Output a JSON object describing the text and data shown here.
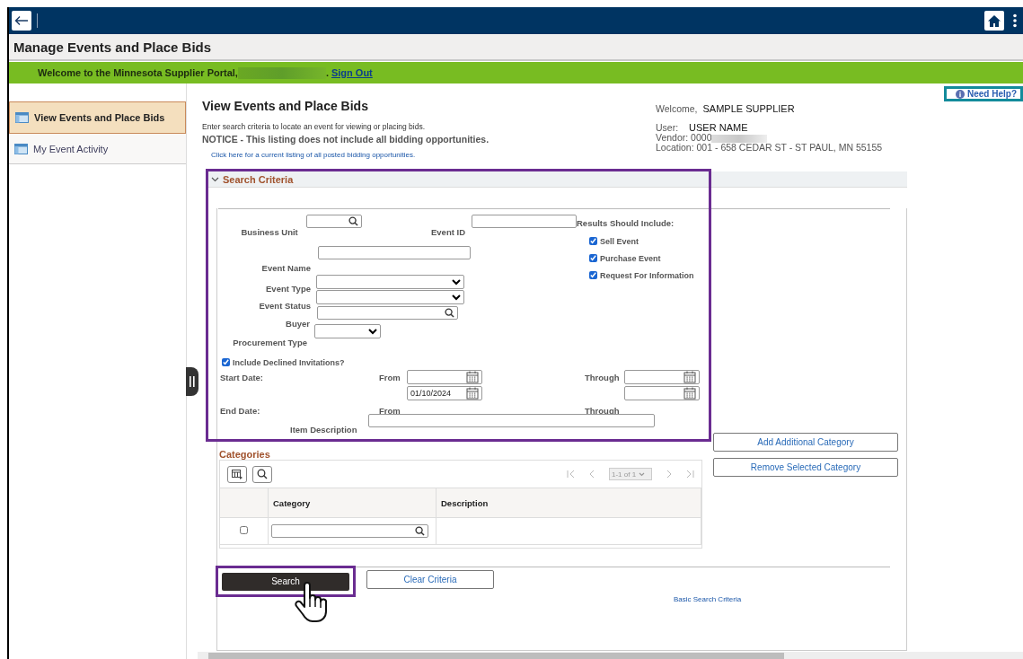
{
  "title": "Manage Events and Place Bids",
  "banner": {
    "text": "Welcome to the Minnesota Supplier Portal,",
    "after_name": ".",
    "sign_out": "Sign Out"
  },
  "sidebar": {
    "items": [
      {
        "label": "View Events and Place Bids",
        "selected": true
      },
      {
        "label": "My Event Activity",
        "selected": false
      }
    ]
  },
  "help_button": "Need Help?",
  "page": {
    "heading": "View Events and Place Bids",
    "instructions": "Enter search criteria to locate an event for viewing or placing bids.",
    "notice": "NOTICE - This listing does not include all bidding opportunities.",
    "notice_link": "Click here for a current listing of all posted bidding opportunities."
  },
  "user_info": {
    "welcome_label": "Welcome,",
    "welcome_name": "SAMPLE SUPPLIER",
    "user_label": "User:",
    "user_name": "USER NAME",
    "vendor": "Vendor: 0000",
    "location": "Location: 001 - 658 CEDAR ST - ST PAUL, MN  55155"
  },
  "search_criteria": {
    "title": "Search Criteria",
    "expanded": true,
    "business_unit": "Business Unit",
    "event_id": "Event ID",
    "event_name": "Event Name",
    "event_type": "Event Type",
    "event_status": "Event Status",
    "buyer": "Buyer",
    "procurement_type": "Procurement Type",
    "results_label": "Results Should Include:",
    "results": [
      {
        "label": "Sell Event",
        "checked": true
      },
      {
        "label": "Purchase Event",
        "checked": true
      },
      {
        "label": "Request For Information",
        "checked": true
      }
    ],
    "include_declined": {
      "label": "Include Declined Invitations?",
      "checked": true
    },
    "start_date": "Start Date:",
    "end_date": "End Date:",
    "from_labels": [
      "From",
      "From"
    ],
    "through_labels": [
      "Through",
      "Through"
    ],
    "end_from_value": "01/10/2024",
    "item_description": "Item Description"
  },
  "categories": {
    "title": "Categories",
    "pager": "1-1 of 1",
    "columns": [
      "Category",
      "Description"
    ],
    "rows": [
      {
        "selected": false
      }
    ]
  },
  "side_buttons": [
    "Add Additional Category",
    "Remove Selected Category"
  ],
  "search_button": "Search",
  "clear_button": "Clear Criteria",
  "basic_link": "Basic Search Criteria"
}
